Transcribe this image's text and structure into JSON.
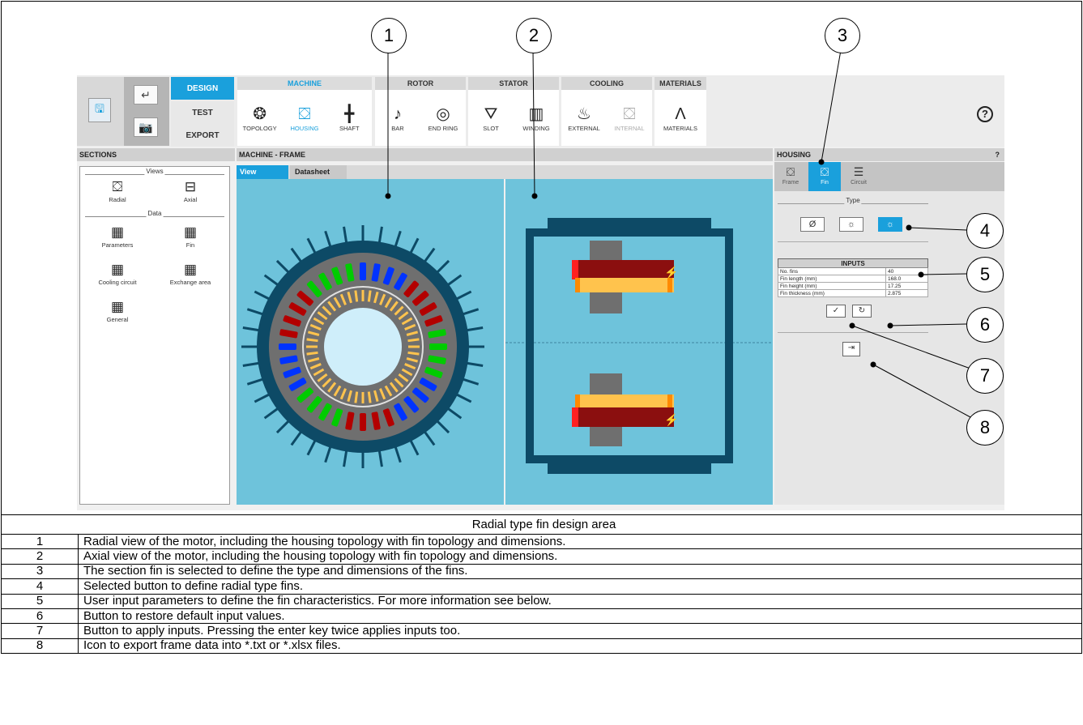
{
  "ribbon": {
    "modes": [
      "DESIGN",
      "TEST",
      "EXPORT"
    ],
    "groups": [
      {
        "title": "MACHINE",
        "tools": [
          "TOPOLOGY",
          "HOUSING",
          "SHAFT"
        ]
      },
      {
        "title": "ROTOR",
        "tools": [
          "BAR",
          "END RING"
        ]
      },
      {
        "title": "STATOR",
        "tools": [
          "SLOT",
          "WINDING"
        ]
      },
      {
        "title": "COOLING",
        "tools": [
          "EXTERNAL",
          "INTERNAL"
        ]
      },
      {
        "title": "MATERIALS",
        "tools": [
          "MATERIALS"
        ]
      }
    ],
    "help": "?"
  },
  "sections": {
    "title": "SECTIONS",
    "views_label": "Views",
    "data_label": "Data",
    "views": [
      "Radial",
      "Axial"
    ],
    "data": [
      "Parameters",
      "Fin",
      "Cooling circuit",
      "Exchange area",
      "General"
    ]
  },
  "center": {
    "title": "MACHINE - FRAME",
    "tabs": [
      "View",
      "Datasheet"
    ]
  },
  "housing": {
    "title": "HOUSING",
    "help": "?",
    "tabs": [
      "Frame",
      "Fin",
      "Circuit"
    ],
    "type_label": "Type",
    "type_buttons": [
      "Ø",
      "☼",
      "☼"
    ],
    "inputs_title": "INPUTS",
    "inputs": [
      {
        "label": "No. fins",
        "value": "40"
      },
      {
        "label": "Fin length (mm)",
        "value": "168.0"
      },
      {
        "label": "Fin height (mm)",
        "value": "17.25"
      },
      {
        "label": "Fin thickness (mm)",
        "value": "2.875"
      }
    ]
  },
  "callouts": [
    "1",
    "2",
    "3",
    "4",
    "5",
    "6",
    "7",
    "8"
  ],
  "caption": "Radial type fin design area",
  "rows": [
    {
      "num": "1",
      "text": "Radial view of the motor, including the housing topology with fin topology and dimensions."
    },
    {
      "num": "2",
      "text": "Axial view of the motor, including the housing topology with fin topology and dimensions."
    },
    {
      "num": "3",
      "text": "The section fin is selected to define the type and dimensions of the fins."
    },
    {
      "num": "4",
      "text": "Selected button to define radial type fins."
    },
    {
      "num": "5",
      "text": "User input parameters to define the fin characteristics. For more information see below."
    },
    {
      "num": "6",
      "text": "Button to restore default input values."
    },
    {
      "num": "7",
      "text": "Button to apply inputs. Pressing the enter key twice applies inputs too."
    },
    {
      "num": "8",
      "text": "Icon to export frame data into *.txt or *.xlsx files."
    }
  ],
  "colors": {
    "accent": "#1aa0dc",
    "view_bg": "#6ec3db",
    "frame_dark": "#0d4a66",
    "rotor_grey": "#6f6f6f"
  }
}
